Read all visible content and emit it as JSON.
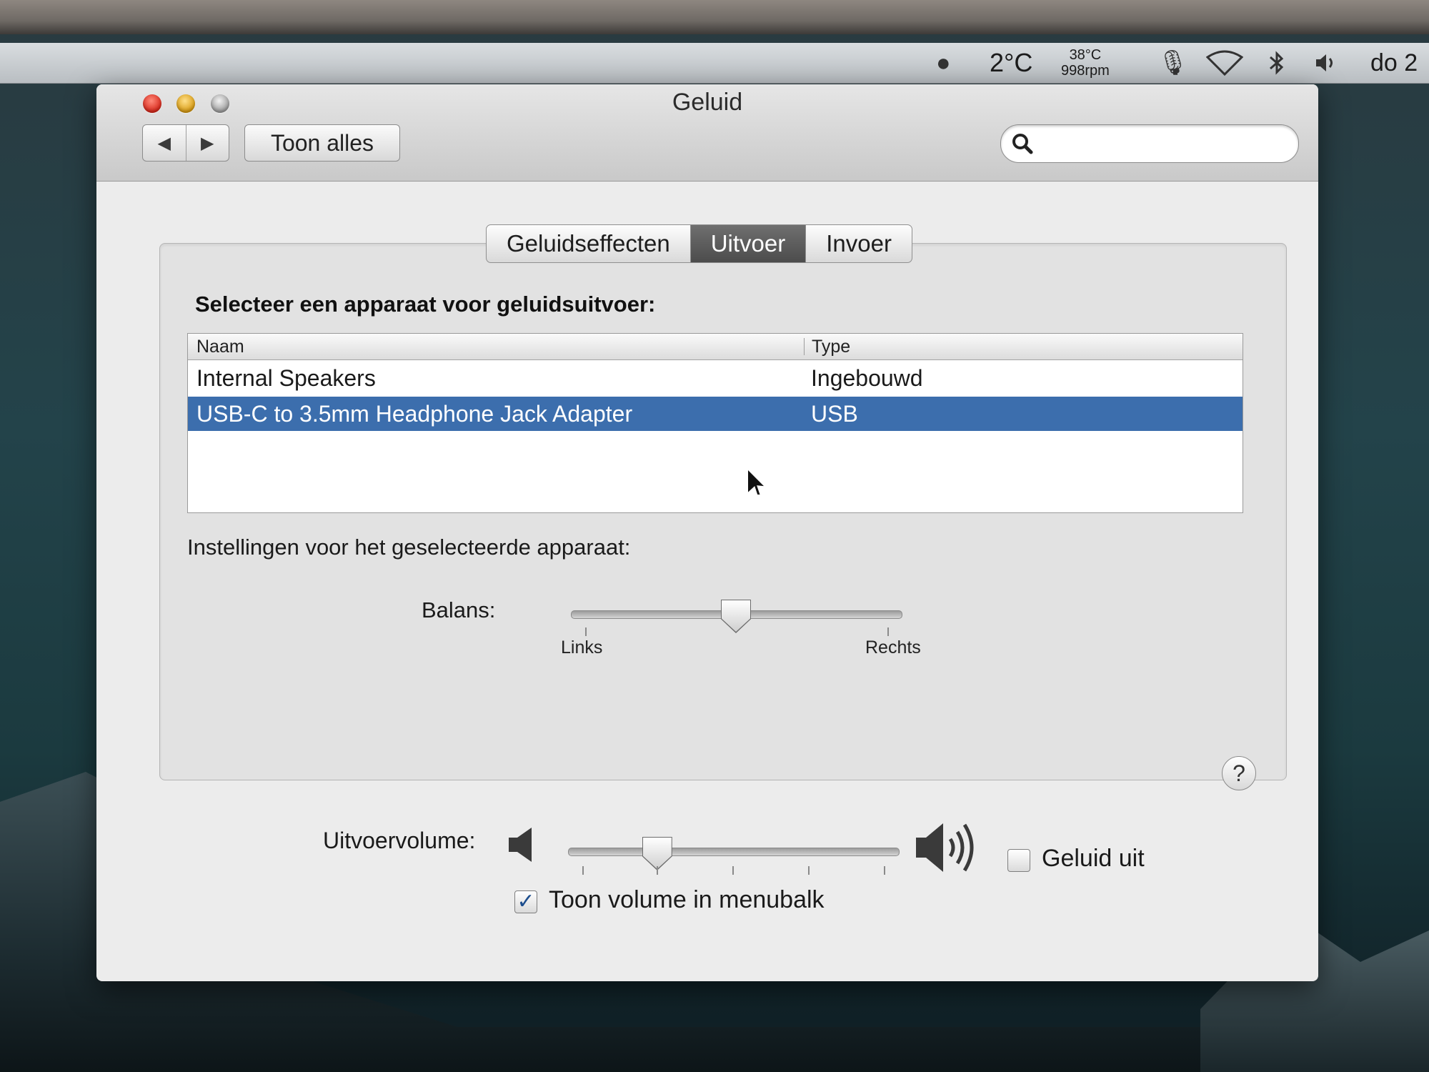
{
  "menubar": {
    "temperature": "2°C",
    "cpu_temp": "38°C",
    "fan_speed": "998rpm",
    "date": "do 2",
    "icons": [
      "weather-icon",
      "microphone-icon",
      "wifi-icon",
      "bluetooth-icon",
      "volume-icon"
    ]
  },
  "window": {
    "title": "Geluid",
    "show_all": "Toon alles",
    "nav_back": "◀",
    "nav_forward": "▶",
    "search_placeholder": ""
  },
  "tabs": [
    {
      "label": "Geluidseffecten",
      "active": false
    },
    {
      "label": "Uitvoer",
      "active": true
    },
    {
      "label": "Invoer",
      "active": false
    }
  ],
  "output": {
    "prompt": "Selecteer een apparaat voor geluidsuitvoer:",
    "columns": {
      "name": "Naam",
      "type": "Type"
    },
    "devices": [
      {
        "name": "Internal Speakers",
        "type": "Ingebouwd",
        "selected": false
      },
      {
        "name": "USB-C to 3.5mm Headphone Jack Adapter",
        "type": "USB",
        "selected": true
      }
    ],
    "settings_title": "Instellingen voor het geselecteerde apparaat:",
    "balance_label": "Balans:",
    "balance_left": "Links",
    "balance_right": "Rechts",
    "balance_value": 0.5,
    "help": "?"
  },
  "volume": {
    "label": "Uitvoervolume:",
    "level": 0.27,
    "mute_label": "Geluid uit",
    "mute_checked": false,
    "menubar_label": "Toon volume in menubalk",
    "menubar_checked": true
  },
  "colors": {
    "selection": "#3c6ead",
    "active_tab": "#5a5a5a"
  }
}
